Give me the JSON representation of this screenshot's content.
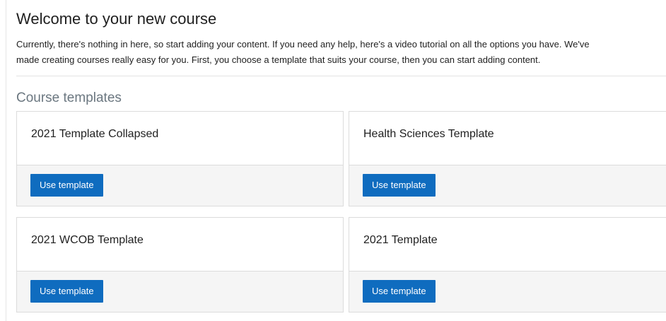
{
  "page": {
    "title": "Welcome to your new course",
    "intro_line_1": "Currently, there's nothing in here, so start adding your content. If you need any help, here's a video tutorial on all the options you have. We've",
    "intro_line_2": "made creating courses really easy for you. First, you choose a template that suits your course, then you can start adding content."
  },
  "templates_section": {
    "title": "Course templates",
    "items": [
      {
        "name": "2021 Template Collapsed",
        "button_label": "Use template"
      },
      {
        "name": "Health Sciences Template",
        "button_label": "Use template"
      },
      {
        "name": "2021 WCOB Template",
        "button_label": "Use template"
      },
      {
        "name": "2021 Template",
        "button_label": "Use template"
      }
    ]
  },
  "colors": {
    "primary_button": "#0f6cbf",
    "card_footer": "#f5f5f5",
    "section_title": "#6b7780"
  }
}
